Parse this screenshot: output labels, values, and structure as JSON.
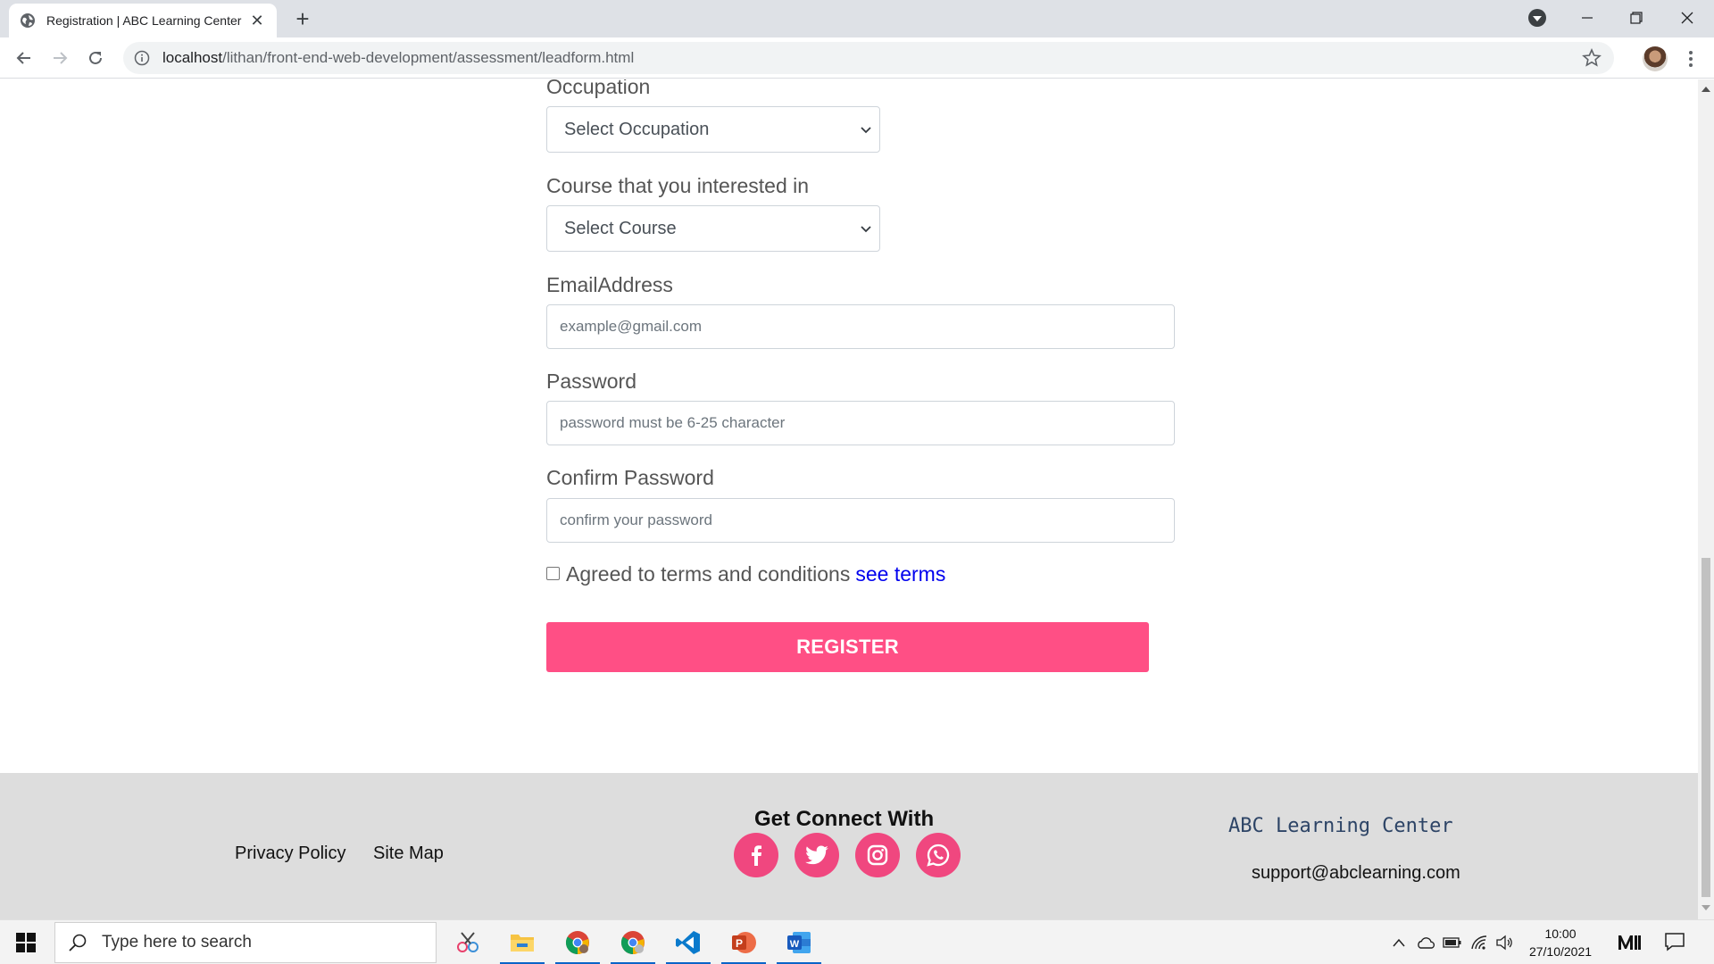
{
  "browser": {
    "tab_title": "Registration | ABC Learning Center",
    "url_host": "localhost",
    "url_path": "/lithan/front-end-web-development/assessment/leadform.html"
  },
  "form": {
    "occupation_label": "Occupation",
    "occupation_value": "Select Occupation",
    "course_label": "Course that you interested in",
    "course_value": "Select Course",
    "email_label": "EmailAddress",
    "email_placeholder": "example@gmail.com",
    "password_label": "Password",
    "password_placeholder": "password must be 6-25 character",
    "confirm_label": "Confirm Password",
    "confirm_placeholder": "confirm your password",
    "terms_text": "Agreed to terms and conditions",
    "terms_link": "see terms",
    "terms_checked": false,
    "register_label": "REGISTER"
  },
  "footer": {
    "privacy_policy": "Privacy Policy",
    "site_map": "Site Map",
    "connect_title": "Get Connect With",
    "social_icons": [
      "facebook-icon",
      "twitter-icon",
      "instagram-icon",
      "whatsapp-icon"
    ],
    "brand": "ABC Learning Center",
    "support_email": "support@abclearning.com"
  },
  "taskbar": {
    "search_placeholder": "Type here to search",
    "time": "10:00",
    "date": "27/10/2021"
  },
  "colors": {
    "accent": "#ff4f85",
    "social": "#f0477f",
    "brand": "#2d4466",
    "link": "#0000ee",
    "footer_bg": "#dddddd"
  }
}
